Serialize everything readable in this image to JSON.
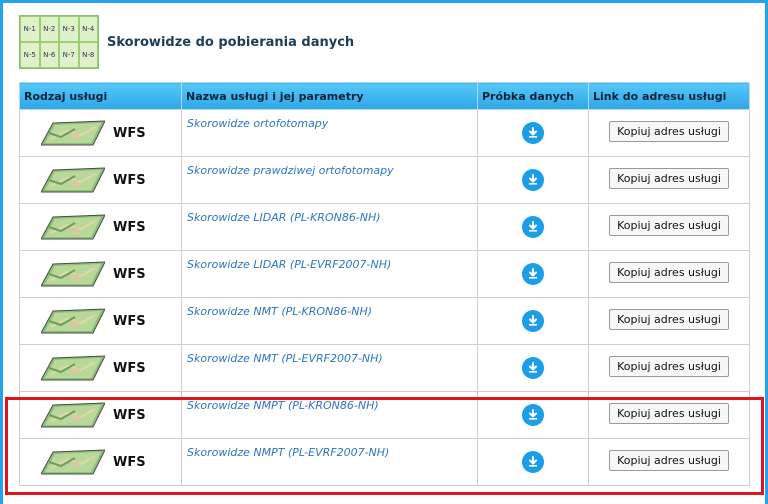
{
  "header": {
    "title": "Skorowidze do pobierania danych",
    "grid_cells": [
      "N-1",
      "N-2",
      "N-3",
      "N-4",
      "N-5",
      "N-6",
      "N-7",
      "N-8"
    ]
  },
  "table": {
    "columns": [
      "Rodzaj usługi",
      "Nazwa usługi i jej parametry",
      "Próbka danych",
      "Link do adresu usługi"
    ],
    "rows": [
      {
        "type": "WFS",
        "name": "Skorowidze ortofotomapy",
        "copy": "Kopiuj adres usługi"
      },
      {
        "type": "WFS",
        "name": "Skorowidze prawdziwej ortofotomapy",
        "copy": "Kopiuj adres usługi"
      },
      {
        "type": "WFS",
        "name": "Skorowidze LIDAR (PL-KRON86-NH)",
        "copy": "Kopiuj adres usługi"
      },
      {
        "type": "WFS",
        "name": "Skorowidze LIDAR (PL-EVRF2007-NH)",
        "copy": "Kopiuj adres usługi"
      },
      {
        "type": "WFS",
        "name": "Skorowidze NMT (PL-KRON86-NH)",
        "copy": "Kopiuj adres usługi"
      },
      {
        "type": "WFS",
        "name": "Skorowidze NMT (PL-EVRF2007-NH)",
        "copy": "Kopiuj adres usługi"
      },
      {
        "type": "WFS",
        "name": "Skorowidze NMPT (PL-KRON86-NH)",
        "copy": "Kopiuj adres usługi"
      },
      {
        "type": "WFS",
        "name": "Skorowidze NMPT (PL-EVRF2007-NH)",
        "copy": "Kopiuj adres usługi"
      }
    ]
  },
  "colors": {
    "header_accent": "#2ea7e6",
    "link": "#2d74c4",
    "download": "#1c9de8",
    "highlight": "#e1141b"
  },
  "icons": {
    "download": "download-icon",
    "map": "map-thumbnail-icon",
    "grid": "sheet-grid-icon"
  }
}
